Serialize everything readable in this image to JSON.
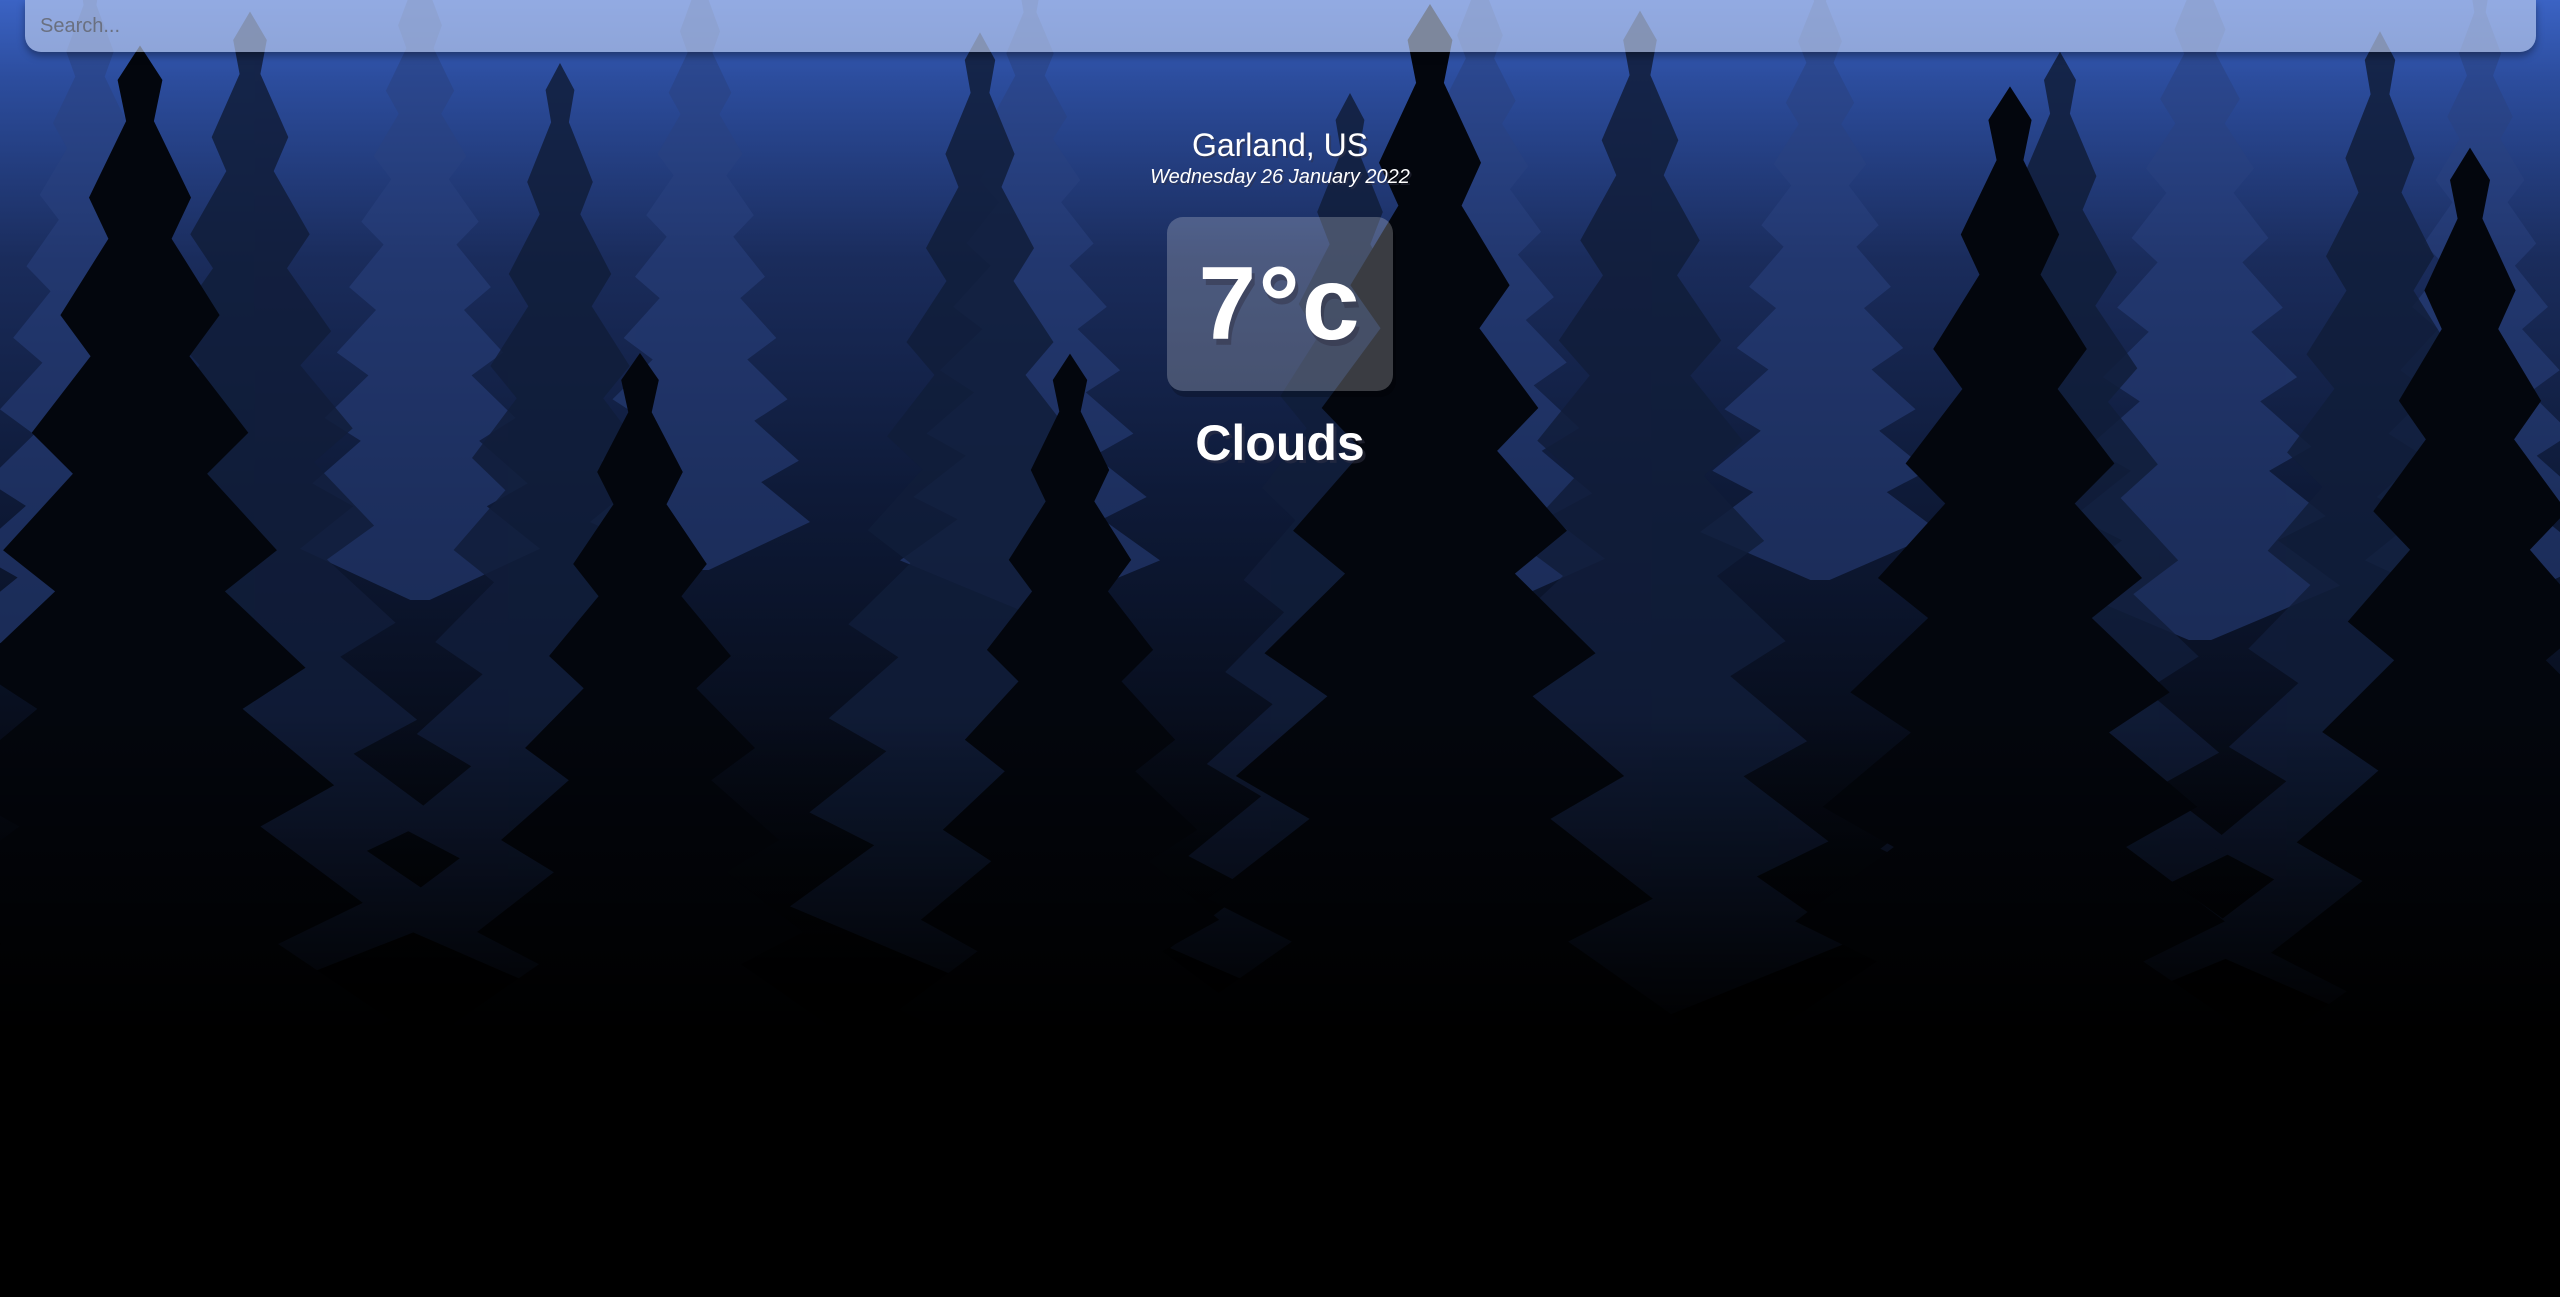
{
  "search": {
    "placeholder": "Search...",
    "value": ""
  },
  "location": {
    "name": "Garland, US",
    "date": "Wednesday 26 January 2022"
  },
  "weather": {
    "temperature": "7°c",
    "condition": "Clouds"
  },
  "background": {
    "scene": "pine forest silhouette at dusk",
    "sky_top": "#3b63c4",
    "sky_mid": "#1a2c5c",
    "ground": "#000000"
  }
}
